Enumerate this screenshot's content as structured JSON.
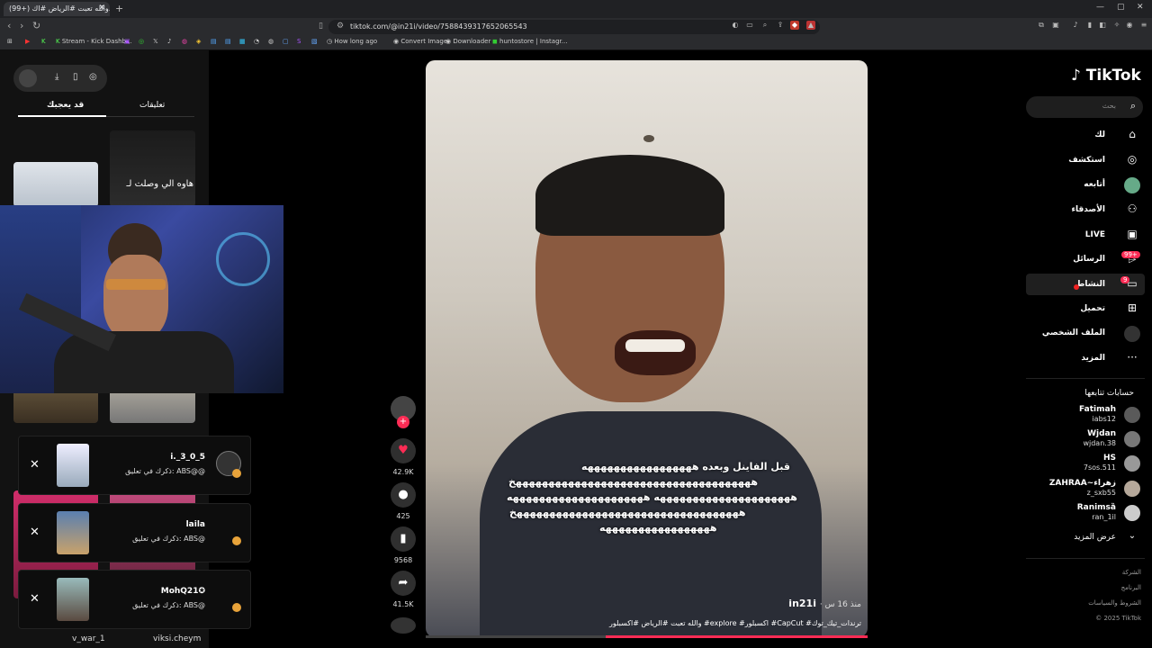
{
  "browser": {
    "tab_title": "(99+) والله تعبت #الرياض #اك...",
    "url": "tiktok.com/@in21i/video/7588439317652065543",
    "bookmarks": [
      "Stream - Kick Dashb...",
      "How long ago",
      "Convert Image",
      "Downloader",
      "huntostore | Instagr..."
    ]
  },
  "left_panel": {
    "tabs": [
      "تعليقات",
      "قد يعجبك"
    ],
    "thumb_text": "هاوه الي وصلت لـ",
    "notifications": [
      {
        "name": "i._3_0_5",
        "text": "ذكرك في تعليق: ABS@@"
      },
      {
        "name": "laila",
        "text": "ذكرك في تعليق: ABS@"
      },
      {
        "name": "MohQ21✪",
        "text": "ذكرك في تعليق: ABS@"
      }
    ],
    "bottom_names": [
      "v_war_1",
      "viksi.cheym"
    ]
  },
  "video": {
    "caption_lines": [
      "قبل الفاينل وبعده هههههههههههههههههه",
      "هههههههههههههههههههههههههههههههههههههخ",
      "هههههههههههههههههههههه هههههههههههههههههههههه",
      "هههههههههههههههههههههههههههههههههههخ",
      "هههههههههههههههههه"
    ],
    "author": "in21i",
    "time": "منذ 16 س",
    "description": "والله تعبت #الرياض #اكسبلور #explore #اكسبلور #CapCut #ترندات_تيك_توك"
  },
  "actions": {
    "likes": "42.9K",
    "comments": "425",
    "saves": "9568",
    "shares": "41.5K"
  },
  "nav": {
    "logo": "TikTok",
    "search_placeholder": "بحث",
    "items": [
      "لك",
      "استكشف",
      "أتابعه",
      "الأصدقاء",
      "LIVE",
      "الرسائل",
      "النشاط",
      "تحميل",
      "الملف الشخصي",
      "المزيد"
    ],
    "messages_badge": "99+",
    "activity_badge": "9",
    "following_header": "حسابات تتابعها",
    "accounts": [
      {
        "name": "Fatimah",
        "handle": "iabs12"
      },
      {
        "name": "Wjdan",
        "handle": "wjdan.38"
      },
      {
        "name": "HS",
        "handle": "7sos.511"
      },
      {
        "name": "ZAHRAA~زهراء",
        "handle": "z_sxb55"
      },
      {
        "name": "Ranimsȁ",
        "handle": "ran_1il"
      }
    ],
    "see_more": "عرض المزيد",
    "footer": [
      "الشركة",
      "البرنامج",
      "الشروط والسياسات",
      "© 2025 TikTok"
    ]
  }
}
